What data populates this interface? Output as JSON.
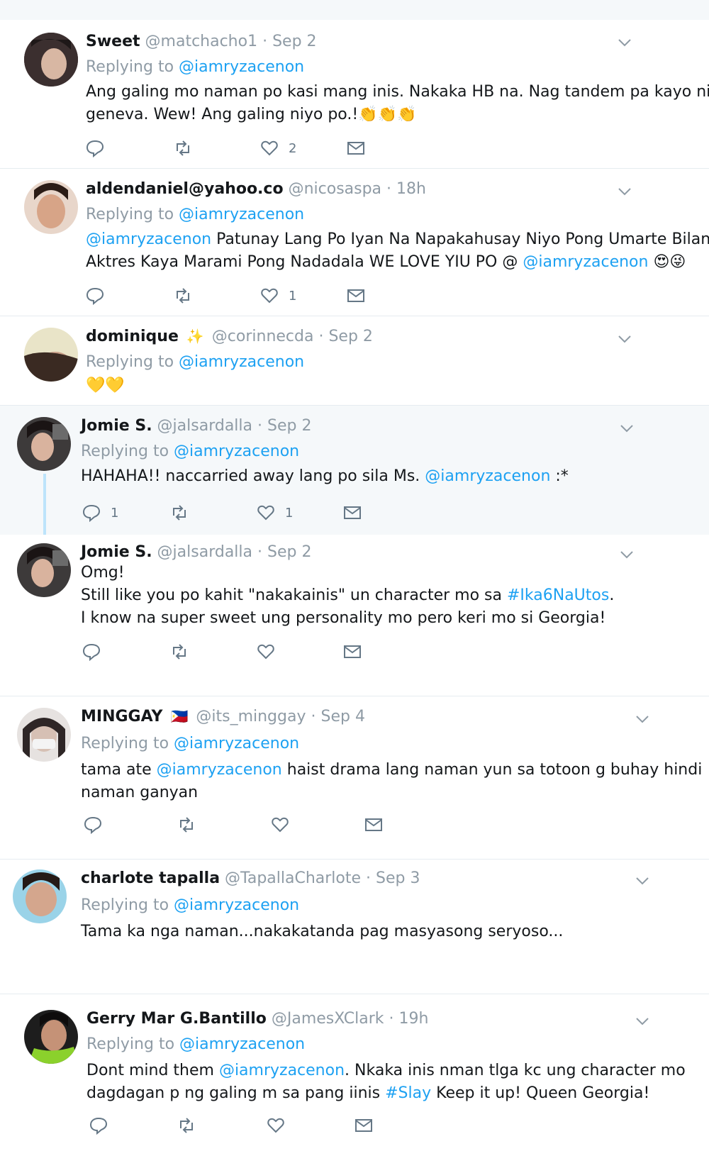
{
  "tweets": [
    {
      "name": "Sweet",
      "handle": "@matchacho1",
      "time": "Sep 2",
      "replying_prefix": "Replying to",
      "replying_to": "@iamryzacenon",
      "lines": [
        "Ang galing mo naman po kasi mang inis. Nakaka HB na. Nag tandem pa kayo ni",
        "geneva. Wew!  Ang galing niyo po.!"
      ],
      "emoji": "👏👏👏",
      "reply_count": "",
      "like_count": "2",
      "avatar_color": "#4a3a3a"
    },
    {
      "name": "aldendaniel@yahoo.co",
      "handle": "@nicosaspa",
      "time": "18h",
      "replying_prefix": "Replying to",
      "replying_to": "@iamryzacenon",
      "line1_mention": "@iamryzacenon",
      "line1_rest": " Patunay Lang Po Iyan Na Napakahusay Niyo Pong Umarte Bilang",
      "line2_text": "Aktres Kaya Marami Pong Nadadala WE LOVE YIU PO @ ",
      "line2_mention": "@iamryzacenon",
      "emoji": "😍😜",
      "like_count": "1",
      "avatar_color": "#c9a48e"
    },
    {
      "name": "dominique",
      "badge": "✨",
      "handle": "@corinnecda",
      "time": "Sep 2",
      "replying_prefix": "Replying to",
      "replying_to": "@iamryzacenon",
      "emoji": "💛💛",
      "avatar_color": "#d9cfb0"
    },
    {
      "name": "Jomie S.",
      "handle": "@jalsardalla",
      "time": "Sep 2",
      "replying_prefix": "Replying to",
      "replying_to": "@iamryzacenon",
      "text_before": "HAHAHA!! naccarried away lang po sila Ms. ",
      "mention": "@iamryzacenon",
      "text_after": "  :*",
      "reply_count": "1",
      "like_count": "1",
      "avatar_color": "#5b4a44"
    },
    {
      "name": "Jomie S.",
      "handle": "@jalsardalla",
      "time": "Sep 2",
      "line1": "Omg!",
      "line2_text": "Still like you po kahit \"nakakainis\" un character mo sa ",
      "line2_hashtag": "#Ika6NaUtos",
      "line2_end": ".",
      "line3": "I know na super sweet ung personality mo pero keri mo si Georgia!",
      "avatar_color": "#5b4a44"
    },
    {
      "name": "MINGGAY",
      "flag": "🇵🇭",
      "handle": "@its_minggay",
      "time": "Sep 4",
      "replying_prefix": "Replying to",
      "replying_to": "@iamryzacenon",
      "line1_text": "tama ate ",
      "line1_mention": "@iamryzacenon",
      "line1_rest": " haist drama lang naman yun sa totoon g buhay hindi",
      "line2": "naman ganyan",
      "avatar_color": "#8a8585"
    },
    {
      "name": "charlote tapalla",
      "handle": "@TapallaCharlote",
      "time": "Sep 3",
      "replying_prefix": "Replying to",
      "replying_to": "@iamryzacenon",
      "line1": "Tama ka nga naman...nakakatanda pag masyasong seryoso...",
      "avatar_color": "#c79a84"
    },
    {
      "name": "Gerry Mar G.Bantillo",
      "handle": "@JamesXClark",
      "time": "19h",
      "replying_prefix": "Replying to",
      "replying_to": "@iamryzacenon",
      "line1_text": "Dont mind them ",
      "line1_mention": "@iamryzacenon",
      "line1_rest": ". Nkaka inis nman tlga kc ung character mo",
      "line2_text": "dagdagan p ng galing m sa pang iinis ",
      "line2_hashtag": "#Slay",
      "line2_rest": " Keep it up! Queen Georgia!",
      "avatar_color": "#7fbf3a"
    }
  ],
  "sep": "·",
  "colors": {
    "link": "#1da1f2",
    "muted": "#8f9ba5",
    "thread": "#bde4fb"
  }
}
